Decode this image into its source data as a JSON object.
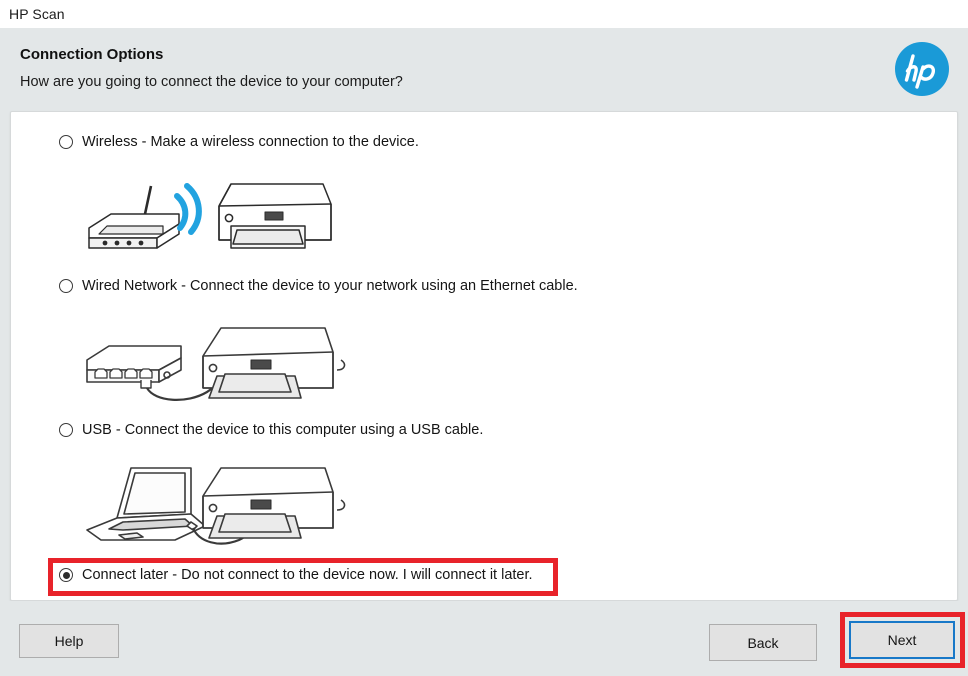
{
  "window": {
    "title": "HP Scan"
  },
  "header": {
    "title": "Connection Options",
    "subtitle": "How are you going to connect the device to your computer?",
    "logo_name": "hp-logo",
    "logo_color": "#1a9ad7",
    "background": "#e3e7e8"
  },
  "options": [
    {
      "id": "wireless",
      "label": "Wireless - Make a wireless connection to the device.",
      "selected": false,
      "illustration": "router-wifi-printer"
    },
    {
      "id": "wired",
      "label": "Wired Network - Connect the device to your network using an Ethernet cable.",
      "selected": false,
      "illustration": "switch-ethernet-printer"
    },
    {
      "id": "usb",
      "label": "USB - Connect the device to this computer using a USB cable.",
      "selected": false,
      "illustration": "laptop-usb-printer"
    },
    {
      "id": "connect-later",
      "label": "Connect later - Do not connect to the device now. I will connect it later.",
      "selected": true,
      "illustration": null
    }
  ],
  "annotations": {
    "color": "#e8232a",
    "selected_option_highlight": "connect-later",
    "primary_button_highlight": "next"
  },
  "footer": {
    "help_label": "Help",
    "back_label": "Back",
    "next_label": "Next",
    "focus_color": "#1878c8"
  }
}
